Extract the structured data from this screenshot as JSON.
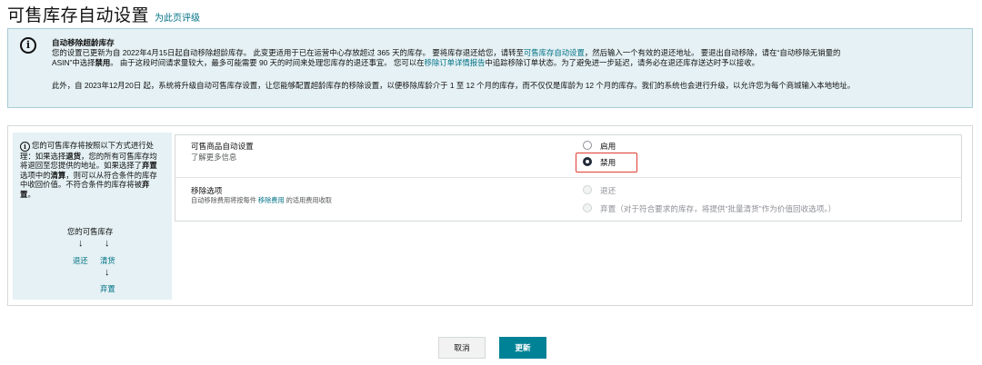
{
  "header": {
    "title": "可售库存自动设置",
    "feedback_link": "为此页评级"
  },
  "banner": {
    "icon": "info-circle-icon",
    "title": "自动移除超龄库存",
    "line1": "您的设置已更新为自 2022年4月15日起自动移除超龄库存。 此变更适用于已在运营中心存放超过 365 天的库存。 要将库存退还给您，请转至",
    "link1": "可售库存自动设置",
    "line1_tail": "，然后输入一个有效的退还地址。 要退出自动移除，请在“自动移除无销量的",
    "line2_head": "ASIN”中选择",
    "line2_bold": "禁用",
    "line2_mid": "。 由于这段时间请求量较大，最多可能需要 90 天的时间来处理您库存的退还事宜。 您可以在",
    "link2": "移除订单详情报告",
    "line2_tail": "中追踪移除订单状态。为了避免进一步延迟，请务必在退还库存送达时予以接收。",
    "line3": "此外，自 2023年12月20日 起，系统将升级自动可售库存设置，让您能够配置超龄库存的移除设置，以便移除库龄介于 1 至 12 个月的库存，而不仅仅是库龄为 12 个月的库存。我们的系统也会进行升级，以允许您为每个商城输入本地地址。"
  },
  "side": {
    "icon": "info-icon",
    "text1": "您的可售库存将按照以下方式进行处理：如果选择",
    "bold1": "退货",
    "text2": "，您的所有可售库存均将退回至您提供的地址。如果选择了",
    "bold2": "弃置",
    "text3": "选项中的",
    "bold3": "清算",
    "text4": "，则可以从符合条件的库存中收回价值。不符合条件的库存将被",
    "bold4": "弃置",
    "text5": "。",
    "flow": {
      "top": "您的可售库存",
      "arrow": "↓",
      "left": "退还",
      "right": "清货",
      "bottom": "弃置"
    }
  },
  "settings": {
    "auto_label": "可售商品自动设置",
    "learn_more": "了解更多信息",
    "option_enable": "启用",
    "option_disable": "禁用",
    "removal_label": "移除选项",
    "removal_sub_head": "自动移除费用将按每件",
    "removal_sub_link": "移除费用",
    "removal_sub_tail": "的适用费用收取",
    "option_return": "退还",
    "option_dispose": "弃置（对于符合要求的库存，将提供“批量清货”作为价值回收选项。）",
    "selected": "禁用"
  },
  "buttons": {
    "cancel": "取消",
    "update": "更新"
  },
  "colors": {
    "accent": "#008296",
    "link": "#007185",
    "banner_bg": "#e5f1f4",
    "highlight": "#e03c31"
  }
}
